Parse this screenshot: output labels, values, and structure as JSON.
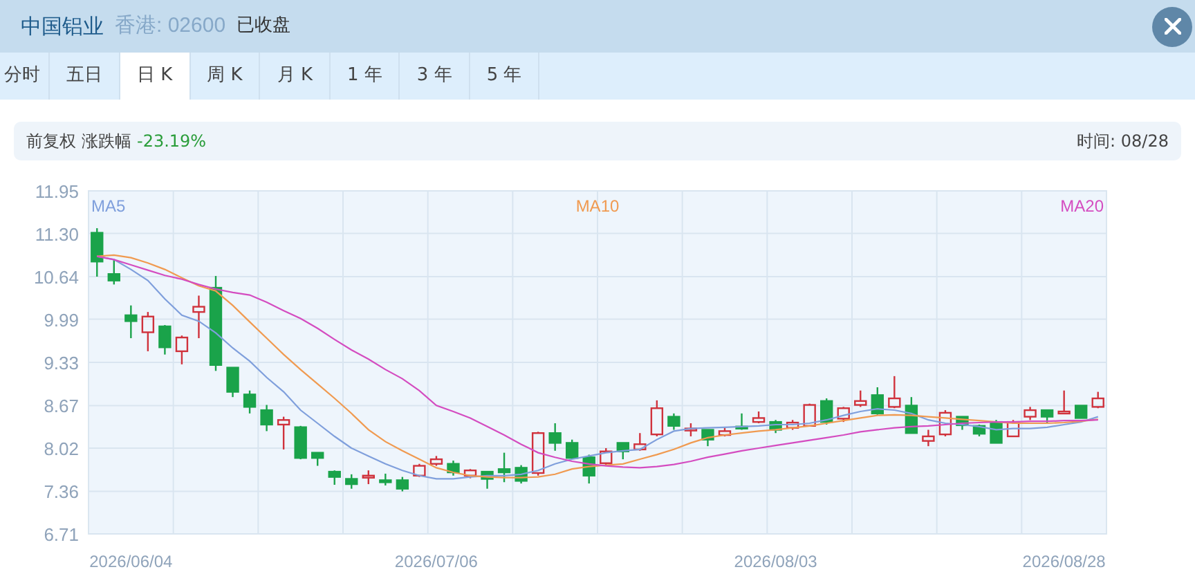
{
  "header": {
    "title": "中国铝业",
    "market_code": "香港: 02600",
    "status": "已收盘"
  },
  "tabs": [
    {
      "label": "分时",
      "selected": false
    },
    {
      "label": "五日",
      "selected": false
    },
    {
      "label": "日 K",
      "selected": true
    },
    {
      "label": "周 K",
      "selected": false
    },
    {
      "label": "月 K",
      "selected": false
    },
    {
      "label": "1 年",
      "selected": false
    },
    {
      "label": "3 年",
      "selected": false
    },
    {
      "label": "5 年",
      "selected": false
    }
  ],
  "info_bar": {
    "adjustment": "前复权",
    "change_label": "涨跌幅",
    "change": "-23.19%",
    "time": "时间: 08/28"
  },
  "chart": {
    "chart_data": {
      "type": "candlestick",
      "grid": true,
      "ylim": [
        6.71,
        11.95
      ],
      "categories": [
        null,
        null,
        "2026/06/04",
        null,
        null,
        null,
        null,
        null,
        null,
        null,
        null,
        null,
        null,
        null,
        null,
        null,
        null,
        null,
        null,
        null,
        "2026/07/06",
        null,
        null,
        null,
        null,
        null,
        null,
        null,
        null,
        null,
        null,
        null,
        null,
        null,
        null,
        null,
        null,
        null,
        null,
        null,
        "2026/08/03",
        null,
        null,
        null,
        null,
        null,
        null,
        null,
        null,
        null,
        null,
        null,
        null,
        null,
        null,
        null,
        null,
        "2026/08/28",
        null,
        null
      ],
      "yticks": [
        {
          "value": 11.95,
          "label": "11.95"
        },
        {
          "value": 11.3,
          "label": "11.30"
        },
        {
          "value": 10.64,
          "label": "10.64"
        },
        {
          "value": 9.99,
          "label": "9.99"
        },
        {
          "value": 9.33,
          "label": "9.33"
        },
        {
          "value": 8.67,
          "label": "8.67"
        },
        {
          "value": 8.02,
          "label": "8.02"
        },
        {
          "value": 7.36,
          "label": "7.36"
        },
        {
          "value": 6.71,
          "label": "6.71"
        }
      ],
      "series": [
        {
          "name": "MA5",
          "type": "line",
          "color": "#7f9fdc",
          "values": [
            10.95,
            10.9,
            10.75,
            10.58,
            10.3,
            10.05,
            9.96,
            9.78,
            9.55,
            9.35,
            9.1,
            8.88,
            8.6,
            8.4,
            8.2,
            8.02,
            7.9,
            7.78,
            7.68,
            7.6,
            7.55,
            7.55,
            7.58,
            7.6,
            7.6,
            7.62,
            7.68,
            7.78,
            7.85,
            7.9,
            7.95,
            7.98,
            8.0,
            8.15,
            8.28,
            8.32,
            8.33,
            8.34,
            8.35,
            8.36,
            8.38,
            8.38,
            8.4,
            8.45,
            8.52,
            8.58,
            8.62,
            8.6,
            8.55,
            8.45,
            8.4,
            8.38,
            8.35,
            8.3,
            8.32,
            8.32,
            8.34,
            8.38,
            8.42,
            8.5
          ]
        },
        {
          "name": "MA10",
          "type": "line",
          "color": "#f09a50",
          "values": [
            10.95,
            10.97,
            10.93,
            10.85,
            10.75,
            10.62,
            10.5,
            10.42,
            10.2,
            9.95,
            9.7,
            9.45,
            9.22,
            9.0,
            8.78,
            8.55,
            8.3,
            8.12,
            7.98,
            7.85,
            7.72,
            7.65,
            7.6,
            7.58,
            7.57,
            7.57,
            7.58,
            7.62,
            7.7,
            7.74,
            7.76,
            7.78,
            7.85,
            7.92,
            8.0,
            8.1,
            8.18,
            8.22,
            8.25,
            8.28,
            8.3,
            8.33,
            8.36,
            8.4,
            8.44,
            8.48,
            8.52,
            8.53,
            8.52,
            8.5,
            8.48,
            8.46,
            8.44,
            8.42,
            8.4,
            8.4,
            8.4,
            8.41,
            8.43,
            8.46
          ]
        },
        {
          "name": "MA20",
          "type": "line",
          "color": "#d44cc0",
          "values": [
            10.95,
            10.9,
            10.82,
            10.74,
            10.66,
            10.6,
            10.52,
            10.45,
            10.4,
            10.36,
            10.25,
            10.12,
            10.0,
            9.85,
            9.68,
            9.52,
            9.38,
            9.22,
            9.08,
            8.9,
            8.67,
            8.58,
            8.48,
            8.35,
            8.22,
            8.08,
            7.95,
            7.88,
            7.82,
            7.78,
            7.75,
            7.73,
            7.72,
            7.74,
            7.77,
            7.82,
            7.88,
            7.93,
            7.98,
            8.02,
            8.06,
            8.1,
            8.14,
            8.18,
            8.22,
            8.27,
            8.3,
            8.33,
            8.35,
            8.36,
            8.38,
            8.4,
            8.41,
            8.42,
            8.42,
            8.43,
            8.43,
            8.44,
            8.44,
            8.45
          ]
        }
      ],
      "ohlc": [
        [
          11.31,
          11.38,
          10.64,
          10.87
        ],
        [
          10.68,
          10.9,
          10.52,
          10.58
        ],
        [
          10.05,
          10.2,
          9.7,
          9.96
        ],
        [
          9.79,
          10.1,
          9.5,
          10.03
        ],
        [
          9.88,
          9.9,
          9.45,
          9.56
        ],
        [
          9.5,
          9.74,
          9.3,
          9.71
        ],
        [
          10.1,
          10.35,
          9.7,
          10.18
        ],
        [
          10.47,
          10.65,
          9.2,
          9.29
        ],
        [
          9.25,
          9.25,
          8.8,
          8.88
        ],
        [
          8.84,
          8.9,
          8.55,
          8.65
        ],
        [
          8.6,
          8.68,
          8.28,
          8.38
        ],
        [
          8.38,
          8.5,
          8.0,
          8.45
        ],
        [
          8.34,
          8.36,
          7.85,
          7.87
        ],
        [
          7.95,
          7.95,
          7.75,
          7.87
        ],
        [
          7.66,
          7.68,
          7.46,
          7.58
        ],
        [
          7.55,
          7.62,
          7.4,
          7.47
        ],
        [
          7.58,
          7.68,
          7.47,
          7.6
        ],
        [
          7.53,
          7.63,
          7.45,
          7.5
        ],
        [
          7.53,
          7.58,
          7.36,
          7.4
        ],
        [
          7.6,
          7.78,
          7.58,
          7.75
        ],
        [
          7.78,
          7.9,
          7.75,
          7.85
        ],
        [
          7.78,
          7.83,
          7.6,
          7.65
        ],
        [
          7.6,
          7.7,
          7.56,
          7.68
        ],
        [
          7.66,
          7.66,
          7.4,
          7.55
        ],
        [
          7.7,
          7.95,
          7.5,
          7.65
        ],
        [
          7.72,
          7.76,
          7.48,
          7.52
        ],
        [
          7.64,
          8.27,
          7.6,
          8.25
        ],
        [
          8.25,
          8.4,
          7.98,
          8.1
        ],
        [
          8.1,
          8.15,
          7.85,
          7.87
        ],
        [
          7.88,
          7.92,
          7.48,
          7.6
        ],
        [
          7.79,
          8.02,
          7.75,
          7.97
        ],
        [
          8.1,
          8.1,
          7.85,
          7.97
        ],
        [
          8.0,
          8.25,
          7.98,
          8.08
        ],
        [
          8.23,
          8.75,
          8.2,
          8.63
        ],
        [
          8.5,
          8.55,
          8.3,
          8.36
        ],
        [
          8.3,
          8.4,
          8.2,
          8.32
        ],
        [
          8.3,
          8.3,
          8.05,
          8.15
        ],
        [
          8.22,
          8.33,
          8.2,
          8.28
        ],
        [
          8.35,
          8.55,
          8.3,
          8.33
        ],
        [
          8.42,
          8.58,
          8.4,
          8.48
        ],
        [
          8.42,
          8.45,
          8.25,
          8.3
        ],
        [
          8.33,
          8.45,
          8.3,
          8.41
        ],
        [
          8.36,
          8.7,
          8.35,
          8.68
        ],
        [
          8.74,
          8.78,
          8.38,
          8.42
        ],
        [
          8.47,
          8.65,
          8.42,
          8.63
        ],
        [
          8.68,
          8.9,
          8.65,
          8.74
        ],
        [
          8.83,
          8.95,
          8.53,
          8.55
        ],
        [
          8.65,
          9.12,
          8.63,
          8.78
        ],
        [
          8.67,
          8.8,
          8.25,
          8.25
        ],
        [
          8.13,
          8.3,
          8.05,
          8.2
        ],
        [
          8.23,
          8.6,
          8.2,
          8.56
        ],
        [
          8.5,
          8.5,
          8.3,
          8.37
        ],
        [
          8.36,
          8.38,
          8.2,
          8.24
        ],
        [
          8.42,
          8.45,
          8.1,
          8.1
        ],
        [
          8.2,
          8.45,
          8.2,
          8.42
        ],
        [
          8.5,
          8.65,
          8.45,
          8.6
        ],
        [
          8.6,
          8.6,
          8.4,
          8.5
        ],
        [
          8.55,
          8.9,
          8.55,
          8.58
        ],
        [
          8.67,
          8.67,
          8.48,
          8.48
        ],
        [
          8.65,
          8.88,
          8.63,
          8.78
        ]
      ]
    }
  }
}
